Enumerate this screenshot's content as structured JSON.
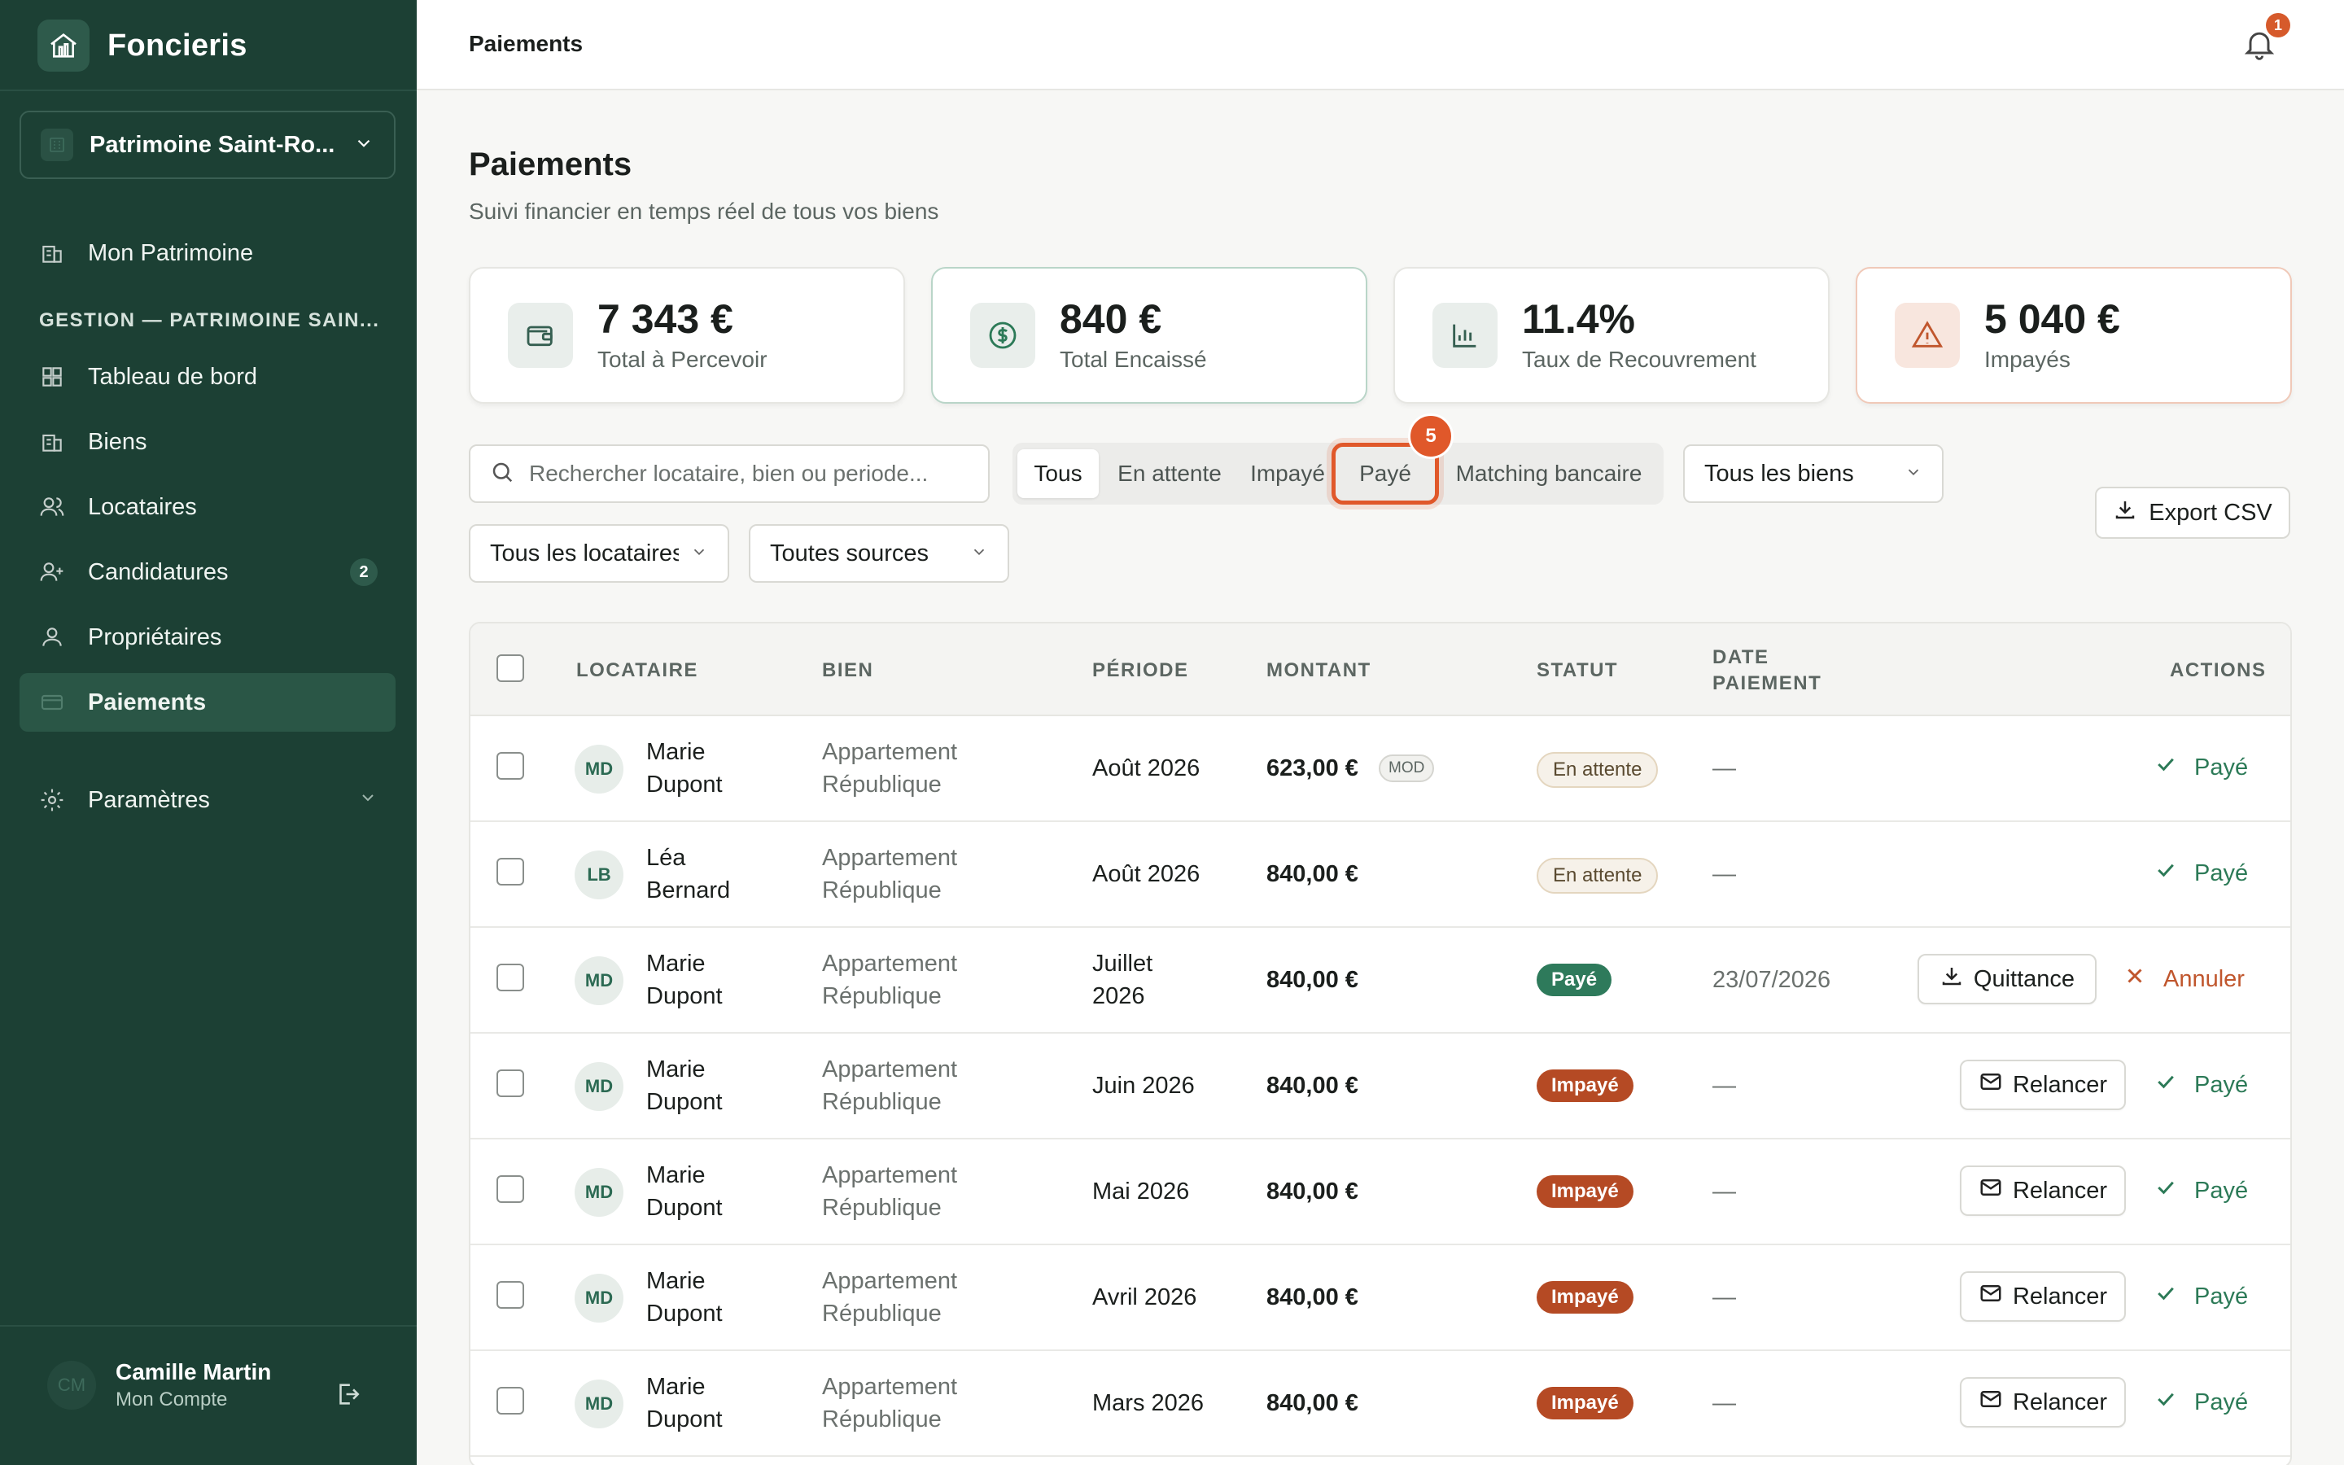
{
  "app": {
    "name": "Foncieris"
  },
  "sidebar": {
    "patrimoine": "Patrimoine Saint-Ro...",
    "top_item": "Mon Patrimoine",
    "section": "GESTION — PATRIMOINE SAIN...",
    "items": [
      {
        "label": "Tableau de bord",
        "icon": "dashboard-icon"
      },
      {
        "label": "Biens",
        "icon": "building-icon"
      },
      {
        "label": "Locataires",
        "icon": "users-icon"
      },
      {
        "label": "Candidatures",
        "icon": "user-plus-icon",
        "badge": "2"
      },
      {
        "label": "Propriétaires",
        "icon": "user-icon"
      },
      {
        "label": "Paiements",
        "icon": "card-icon",
        "active": true
      }
    ],
    "settings": "Paramètres",
    "user": {
      "initials": "CM",
      "name": "Camille Martin",
      "sub": "Mon Compte"
    }
  },
  "topbar": {
    "title": "Paiements",
    "notifications": "1"
  },
  "page": {
    "title": "Paiements",
    "subtitle": "Suivi financier en temps réel de tous vos biens"
  },
  "kpis": [
    {
      "value": "7 343 €",
      "label": "Total à Percevoir",
      "icon": "wallet-icon"
    },
    {
      "value": "840 €",
      "label": "Total Encaissé",
      "icon": "dollar-circle-icon"
    },
    {
      "value": "11.4%",
      "label": "Taux de Recouvrement",
      "icon": "bar-chart-icon"
    },
    {
      "value": "5 040 €",
      "label": "Impayés",
      "icon": "warning-icon"
    }
  ],
  "filters": {
    "search_placeholder": "Rechercher locataire, bien ou periode...",
    "tabs": [
      "Tous",
      "En attente",
      "Impayé",
      "Payé",
      "Matching bancaire"
    ],
    "active_tab": "Tous",
    "highlight_badge": "5",
    "biens": "Tous les biens",
    "locataires": "Tous les locataires",
    "sources": "Toutes sources",
    "export": "Export CSV"
  },
  "table": {
    "headers": {
      "locataire": "LOCATAIRE",
      "bien": "BIEN",
      "periode": "PÉRIODE",
      "montant": "MONTANT",
      "statut": "STATUT",
      "date1": "DATE",
      "date2": "PAIEMENT",
      "actions": "ACTIONS"
    },
    "rows": [
      {
        "initials": "MD",
        "first": "Marie",
        "last": "Dupont",
        "bien1": "Appartement",
        "bien2": "République",
        "periode": "Août 2026",
        "montant": "623,00 €",
        "mod": "MOD",
        "statut": "En attente",
        "date": "—",
        "actions": [
          "Payé"
        ]
      },
      {
        "initials": "LB",
        "first": "Léa",
        "last": "Bernard",
        "bien1": "Appartement",
        "bien2": "République",
        "periode": "Août 2026",
        "montant": "840,00 €",
        "statut": "En attente",
        "date": "—",
        "actions": [
          "Payé"
        ]
      },
      {
        "initials": "MD",
        "first": "Marie",
        "last": "Dupont",
        "bien1": "Appartement",
        "bien2": "République",
        "periode": "Juillet 2026",
        "periode1": "Juillet",
        "periode2": "2026",
        "montant": "840,00 €",
        "statut": "Payé",
        "date": "23/07/2026",
        "actions": [
          "Quittance",
          "Annuler"
        ]
      },
      {
        "initials": "MD",
        "first": "Marie",
        "last": "Dupont",
        "bien1": "Appartement",
        "bien2": "République",
        "periode": "Juin 2026",
        "montant": "840,00 €",
        "statut": "Impayé",
        "date": "—",
        "actions": [
          "Relancer",
          "Payé"
        ]
      },
      {
        "initials": "MD",
        "first": "Marie",
        "last": "Dupont",
        "bien1": "Appartement",
        "bien2": "République",
        "periode": "Mai 2026",
        "montant": "840,00 €",
        "statut": "Impayé",
        "date": "—",
        "actions": [
          "Relancer",
          "Payé"
        ]
      },
      {
        "initials": "MD",
        "first": "Marie",
        "last": "Dupont",
        "bien1": "Appartement",
        "bien2": "République",
        "periode": "Avril 2026",
        "montant": "840,00 €",
        "statut": "Impayé",
        "date": "—",
        "actions": [
          "Relancer",
          "Payé"
        ]
      },
      {
        "initials": "MD",
        "first": "Marie",
        "last": "Dupont",
        "bien1": "Appartement",
        "bien2": "République",
        "periode": "Mars 2026",
        "montant": "840,00 €",
        "statut": "Impayé",
        "date": "—",
        "actions": [
          "Relancer",
          "Payé"
        ]
      }
    ]
  },
  "colors": {
    "sidebar": "#1c4034",
    "accent_green": "#2e7a5b",
    "unpaid": "#b54a24",
    "highlight": "#e0582a"
  }
}
